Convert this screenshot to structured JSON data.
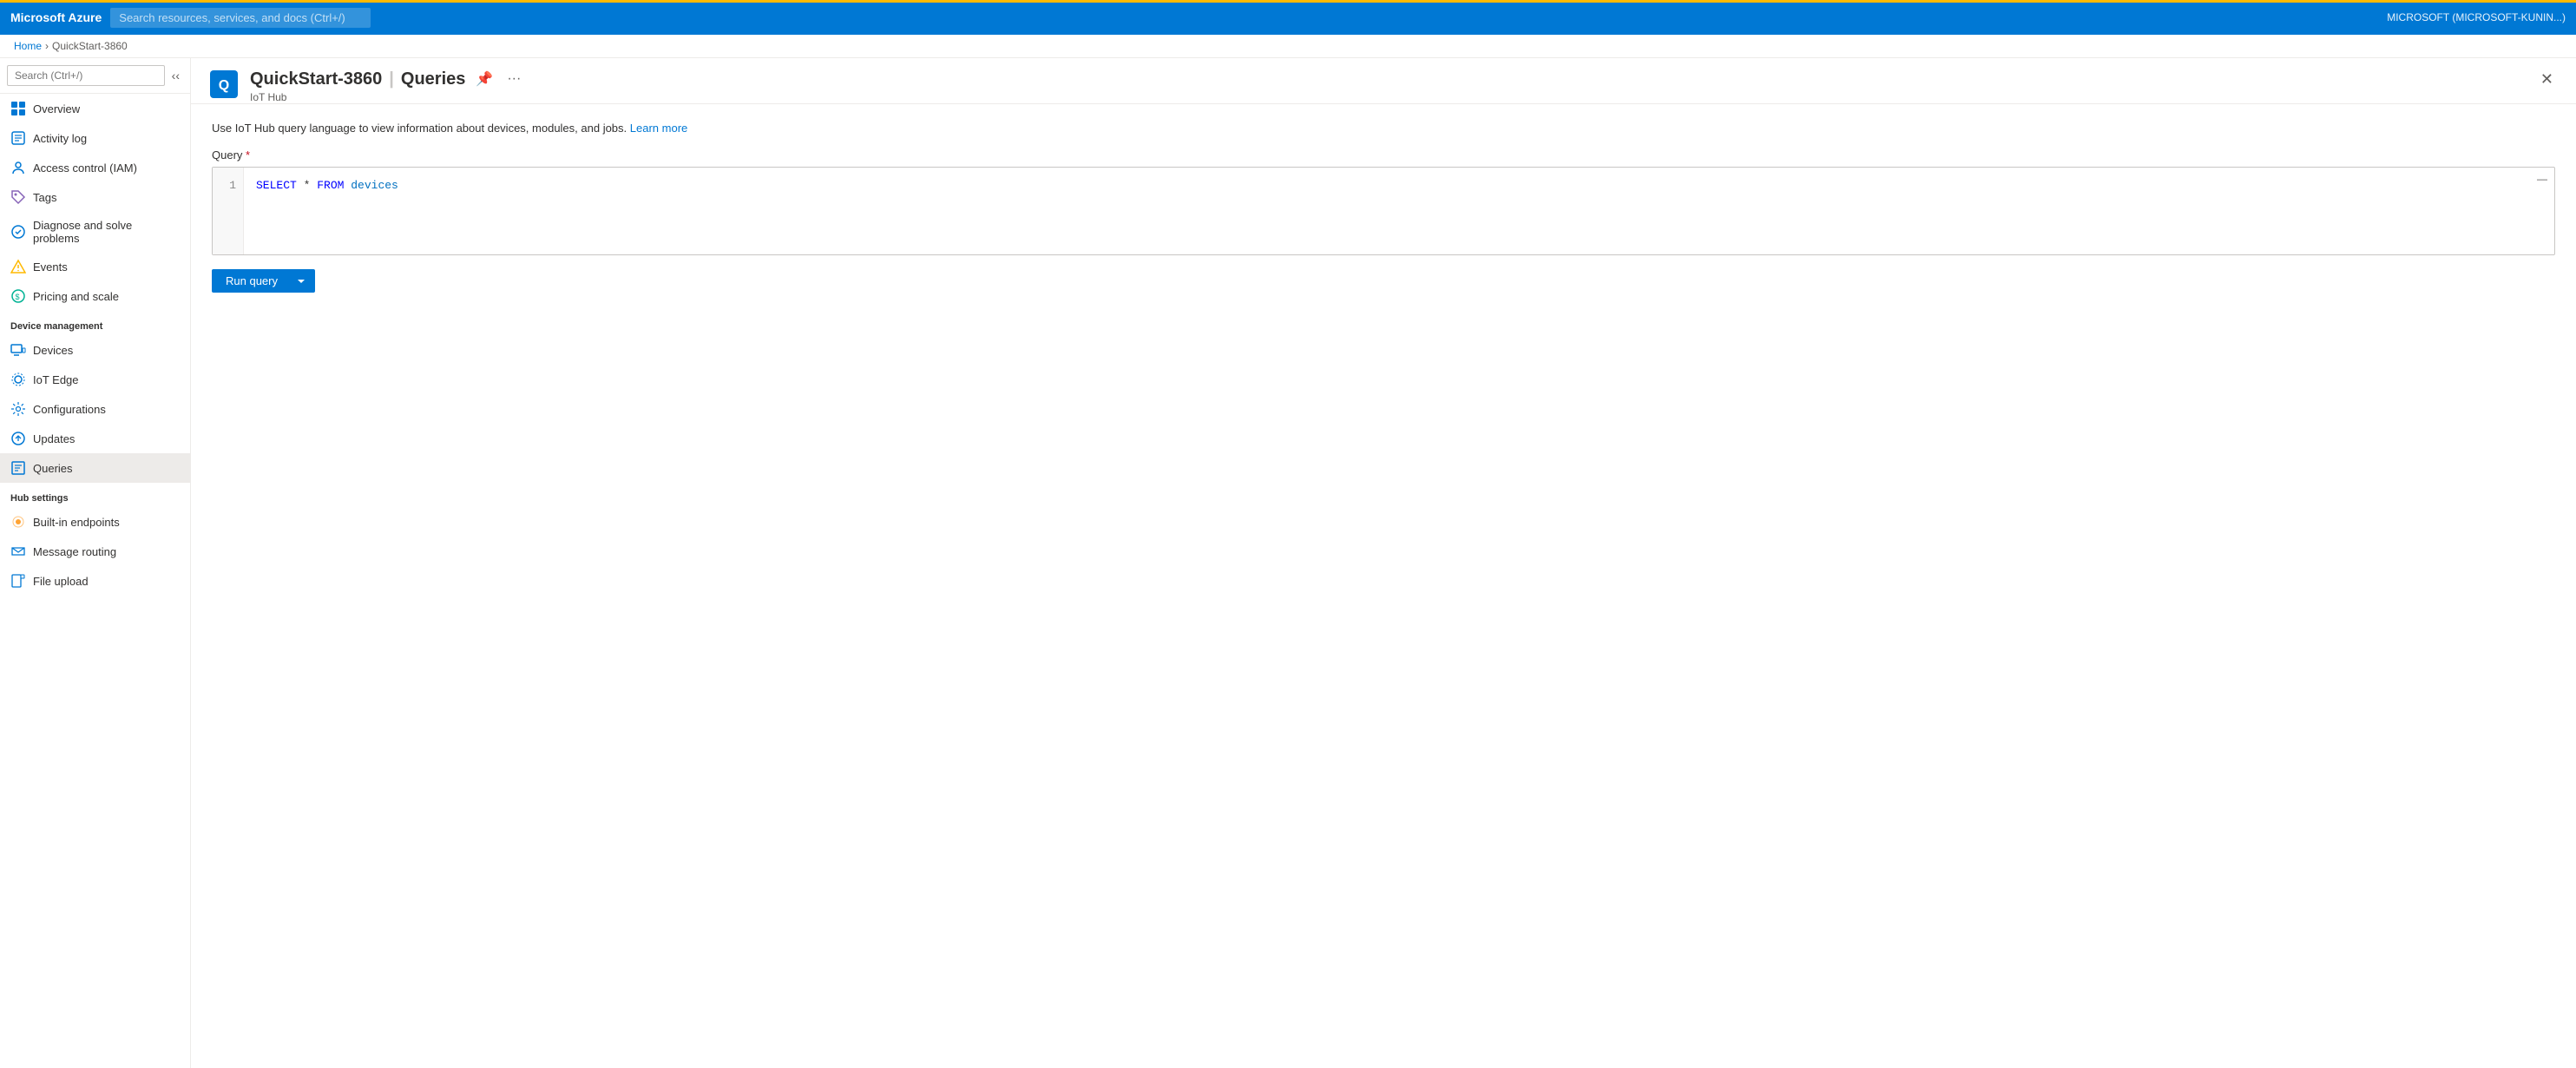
{
  "topBar": {
    "brand": "Microsoft Azure",
    "searchPlaceholder": "Search resources, services, and docs (Ctrl+/)",
    "userInfo": "MICROSOFT (MICROSOFT-KUNIN...)"
  },
  "breadcrumb": {
    "home": "Home",
    "resource": "QuickStart-3860"
  },
  "pageHeader": {
    "title": "QuickStart-3860",
    "separator": "|",
    "pageName": "Queries",
    "subtitle": "IoT Hub"
  },
  "sidebar": {
    "searchPlaceholder": "Search (Ctrl+/)",
    "items": [
      {
        "id": "overview",
        "label": "Overview",
        "icon": "overview",
        "active": false
      },
      {
        "id": "activity-log",
        "label": "Activity log",
        "icon": "activity",
        "active": false
      },
      {
        "id": "access-control",
        "label": "Access control (IAM)",
        "icon": "iam",
        "active": false
      },
      {
        "id": "tags",
        "label": "Tags",
        "icon": "tags",
        "active": false
      },
      {
        "id": "diagnose",
        "label": "Diagnose and solve problems",
        "icon": "diagnose",
        "active": false
      },
      {
        "id": "events",
        "label": "Events",
        "icon": "events",
        "active": false
      },
      {
        "id": "pricing",
        "label": "Pricing and scale",
        "icon": "pricing",
        "active": false
      }
    ],
    "deviceManagement": {
      "header": "Device management",
      "items": [
        {
          "id": "devices",
          "label": "Devices",
          "icon": "devices",
          "active": false
        },
        {
          "id": "iot-edge",
          "label": "IoT Edge",
          "icon": "iot-edge",
          "active": false
        },
        {
          "id": "configurations",
          "label": "Configurations",
          "icon": "configurations",
          "active": false
        },
        {
          "id": "updates",
          "label": "Updates",
          "icon": "updates",
          "active": false
        },
        {
          "id": "queries",
          "label": "Queries",
          "icon": "queries",
          "active": true
        }
      ]
    },
    "hubSettings": {
      "header": "Hub settings",
      "items": [
        {
          "id": "built-in-endpoints",
          "label": "Built-in endpoints",
          "icon": "endpoints",
          "active": false
        },
        {
          "id": "message-routing",
          "label": "Message routing",
          "icon": "routing",
          "active": false
        },
        {
          "id": "file-upload",
          "label": "File upload",
          "icon": "file-upload",
          "active": false
        }
      ]
    }
  },
  "content": {
    "infoText": "Use IoT Hub query language to view information about devices, modules, and jobs.",
    "learnMoreLabel": "Learn more",
    "queryLabel": "Query",
    "queryRequired": true,
    "lineNumbers": [
      "1"
    ],
    "queryCode": {
      "keyword1": "SELECT",
      "wildcard": " * ",
      "keyword2": "FROM",
      "table": " devices"
    },
    "runQueryButton": "Run query"
  }
}
